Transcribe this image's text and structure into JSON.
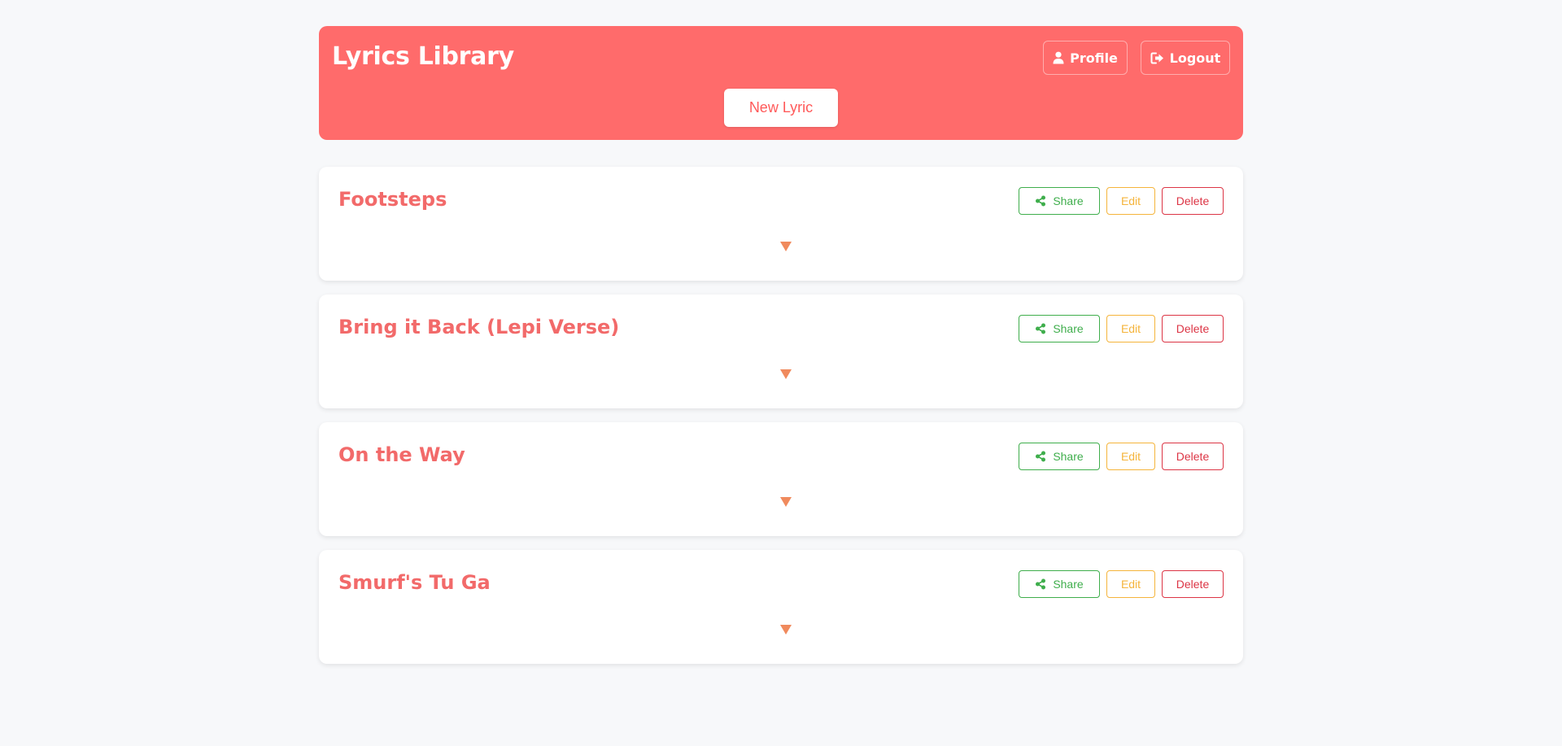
{
  "header": {
    "title": "Lyrics Library",
    "profile_label": "Profile",
    "logout_label": "Logout",
    "new_lyric_label": "New Lyric"
  },
  "lyrics": [
    {
      "title": "Footsteps",
      "share_label": "Share",
      "edit_label": "Edit",
      "delete_label": "Delete",
      "toggle_glyph": "▼"
    },
    {
      "title": "Bring it Back (Lepi Verse)",
      "share_label": "Share",
      "edit_label": "Edit",
      "delete_label": "Delete",
      "toggle_glyph": "▼"
    },
    {
      "title": "On the Way",
      "share_label": "Share",
      "edit_label": "Edit",
      "delete_label": "Delete",
      "toggle_glyph": "▼"
    },
    {
      "title": "Smurf's Tu Ga",
      "share_label": "Share",
      "edit_label": "Edit",
      "delete_label": "Delete",
      "toggle_glyph": "▼"
    }
  ],
  "colors": {
    "background": "#f7f8fa",
    "header_bg": "#ff6b6b",
    "title_accent": "#f26a6a",
    "share": "#3fae4c",
    "edit": "#f5b43b",
    "delete": "#dc3545",
    "toggle": "#f08a5d"
  },
  "icons": {
    "profile": "user-icon",
    "logout": "sign-out-icon",
    "share": "share-nodes-icon",
    "toggle": "caret-down-icon"
  }
}
